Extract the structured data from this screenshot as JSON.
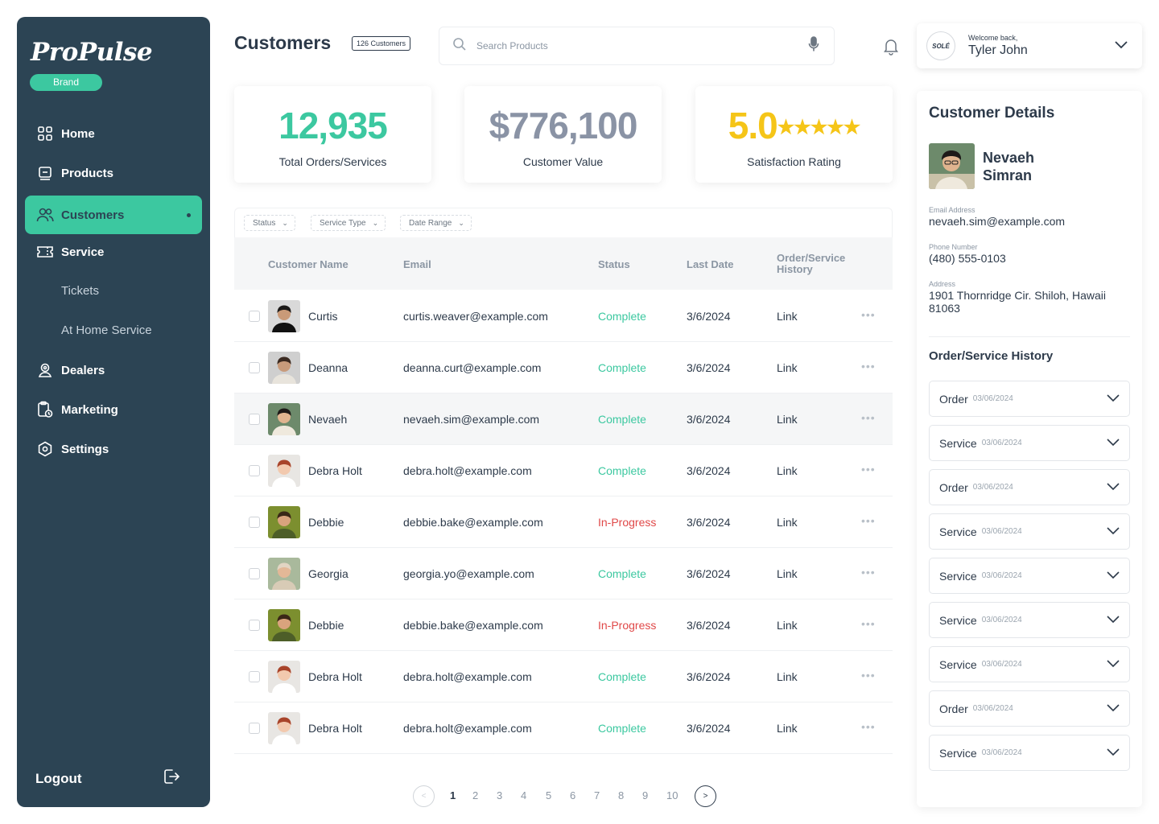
{
  "brand": {
    "logo": "ProPulse",
    "badge": "Brand"
  },
  "nav": {
    "home": "Home",
    "products": "Products",
    "customers": "Customers",
    "service": "Service",
    "tickets": "Tickets",
    "at_home_service": "At Home Service",
    "dealers": "Dealers",
    "marketing": "Marketing",
    "settings": "Settings",
    "logout": "Logout"
  },
  "header": {
    "title": "Customers",
    "count_badge": "126 Customers",
    "search_placeholder": "Search Products"
  },
  "user": {
    "logo_text": "SOLÉ",
    "welcome": "Welcome back,",
    "name": "Tyler John"
  },
  "stats": [
    {
      "value": "12,935",
      "label": "Total Orders/Services",
      "color": "#3cc8a0"
    },
    {
      "value": "$776,100",
      "label": "Customer Value",
      "color": "#8a93a5"
    },
    {
      "value": "5.0",
      "stars": "★★★★★",
      "rating": 5,
      "label": "Satisfaction Rating",
      "color": "#f5c518"
    }
  ],
  "filters": {
    "status": "Status",
    "service_type": "Service Type",
    "date_range": "Date Range"
  },
  "table": {
    "headers": {
      "name": "Customer Name",
      "email": "Email",
      "status": "Status",
      "date": "Last Date",
      "history": "Order/Service History"
    },
    "rows": [
      {
        "name": "Curtis",
        "email": "curtis.weaver@example.com",
        "status": "Complete",
        "date": "3/6/2024",
        "history": "Link",
        "more": "•••"
      },
      {
        "name": "Deanna",
        "email": "deanna.curt@example.com",
        "status": "Complete",
        "date": "3/6/2024",
        "history": "Link",
        "more": "•••"
      },
      {
        "name": "Nevaeh",
        "email": "nevaeh.sim@example.com",
        "status": "Complete",
        "date": "3/6/2024",
        "history": "Link",
        "more": "•••"
      },
      {
        "name": "Debra Holt",
        "email": "debra.holt@example.com",
        "status": "Complete",
        "date": "3/6/2024",
        "history": "Link",
        "more": "•••"
      },
      {
        "name": "Debbie",
        "email": "debbie.bake@example.com",
        "status": "In-Progress",
        "date": "3/6/2024",
        "history": "Link",
        "more": "•••"
      },
      {
        "name": "Georgia",
        "email": "georgia.yo@example.com",
        "status": "Complete",
        "date": "3/6/2024",
        "history": "Link",
        "more": "•••"
      },
      {
        "name": "Debbie",
        "email": "debbie.bake@example.com",
        "status": "In-Progress",
        "date": "3/6/2024",
        "history": "Link",
        "more": "•••"
      },
      {
        "name": "Debra Holt",
        "email": "debra.holt@example.com",
        "status": "Complete",
        "date": "3/6/2024",
        "history": "Link",
        "more": "•••"
      },
      {
        "name": "Debra Holt",
        "email": "debra.holt@example.com",
        "status": "Complete",
        "date": "3/6/2024",
        "history": "Link",
        "more": "•••"
      }
    ]
  },
  "status_colors": {
    "complete": "#3cc8a0",
    "in_progress": "#e04848"
  },
  "pagination": {
    "prev": "<",
    "next": ">",
    "pages": [
      "1",
      "2",
      "3",
      "4",
      "5",
      "6",
      "7",
      "8",
      "9",
      "10"
    ],
    "current": "1"
  },
  "details": {
    "title": "Customer Details",
    "name": "Nevaeh Simran",
    "email_label": "Email Address",
    "email": "nevaeh.sim@example.com",
    "phone_label": "Phone Number",
    "phone": "(480) 555-0103",
    "address_label": "Address",
    "address": "1901 Thornridge Cir. Shiloh, Hawaii 81063",
    "history_title": "Order/Service History",
    "history": [
      {
        "type": "Order",
        "date": "03/06/2024"
      },
      {
        "type": "Service",
        "date": "03/06/2024"
      },
      {
        "type": "Order",
        "date": "03/06/2024"
      },
      {
        "type": "Service",
        "date": "03/06/2024"
      },
      {
        "type": "Service",
        "date": "03/06/2024"
      },
      {
        "type": "Service",
        "date": "03/06/2024"
      },
      {
        "type": "Service",
        "date": "03/06/2024"
      },
      {
        "type": "Order",
        "date": "03/06/2024"
      },
      {
        "type": "Service",
        "date": "03/06/2024"
      }
    ]
  },
  "colors": {
    "sidebar": "#2c4454",
    "accent": "#3cc8a0",
    "text": "#2d3a4a",
    "muted": "#8b96a3"
  }
}
